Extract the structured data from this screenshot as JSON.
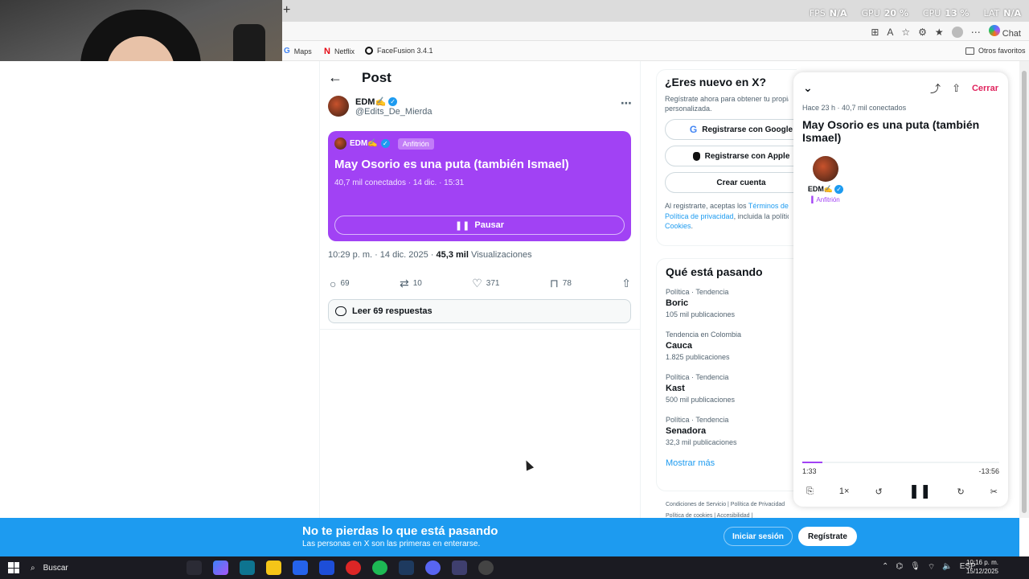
{
  "perf": {
    "fps_label": "FPS",
    "fps_value": "N/A",
    "gpu_label": "GPU",
    "gpu_value": "20 %",
    "cpu_label": "CPU",
    "cpu_value": "13 %",
    "lat_label": "LAT",
    "lat_value": "N/A"
  },
  "browser": {
    "new_tab": "+",
    "chat_label": "Chat",
    "favorites": {
      "maps": "Maps",
      "netflix": "Netflix",
      "facefusion": "FaceFusion 3.4.1",
      "other": "Otros favoritos"
    }
  },
  "post": {
    "header_title": "Post",
    "author_name": "EDM✍️",
    "author_handle": "@Edits_De_Mierda",
    "space": {
      "host_name": "EDM✍️",
      "host_badge": "Anfitrión",
      "title": "May Osorio es una puta (también Ismael)",
      "meta": "40,7 mil conectados · 14 dic. · 15:31",
      "pause_label": "Pausar"
    },
    "timestamp": "10:29 p. m. · 14 dic. 2025 · ",
    "views_count": "45,3 mil",
    "views_label": " Visualizaciones",
    "actions": {
      "replies": "69",
      "reposts": "10",
      "likes": "371",
      "bookmarks": "78"
    },
    "read_replies": "Leer 69 respuestas"
  },
  "signup_box": {
    "title": "¿Eres nuevo en X?",
    "subtitle_line1": "Regístrate ahora para obtener tu propia cronología",
    "subtitle_line2": "personalizada.",
    "google_label": "Registrarse con Google",
    "apple_label": "Registrarse con Apple",
    "create_label": "Crear cuenta",
    "terms_prefix": "Al registrarte, aceptas los ",
    "terms_link": "Términos de servicio",
    "privacy_link": "Política de privacidad",
    "privacy_suffix": ", incluida la política de",
    "cookies_link": "Cookies",
    "cookies_suffix": "."
  },
  "trends": {
    "title": "Qué está pasando",
    "items": [
      {
        "category": "Política · Tendencia",
        "name": "Boric",
        "count": "105 mil publicaciones"
      },
      {
        "category": "Tendencia en Colombia",
        "name": "Cauca",
        "count": "1.825 publicaciones"
      },
      {
        "category": "Política · Tendencia",
        "name": "Kast",
        "count": "500 mil publicaciones"
      },
      {
        "category": "Política · Tendencia",
        "name": "Senadora",
        "count": "32,3 mil publicaciones"
      }
    ],
    "show_more": "Mostrar más",
    "footer_line1": "Condiciones de Servicio  |  Política de Privacidad",
    "footer_line2": "Política de cookies  |  Accesibilidad  |"
  },
  "player": {
    "close_label": "Cerrar",
    "meta": "Hace 23 h · 40,7 mil conectados",
    "title": "May Osorio es una puta (también Ismael)",
    "host_name": "EDM✍️",
    "host_role": "Anfitrión",
    "elapsed": "1:33",
    "remaining": "-13:56",
    "speed": "1×",
    "progress": 0.1
  },
  "banner": {
    "title": "No te pierdas lo que está pasando",
    "subtitle": "Las personas en X son las primeras en enterarse.",
    "login_label": "Iniciar sesión",
    "signup_label": "Regístrate"
  },
  "taskbar": {
    "search_placeholder": "Buscar",
    "lang": "ESP",
    "time": "10:16 p. m.",
    "date": "15/12/2025"
  }
}
